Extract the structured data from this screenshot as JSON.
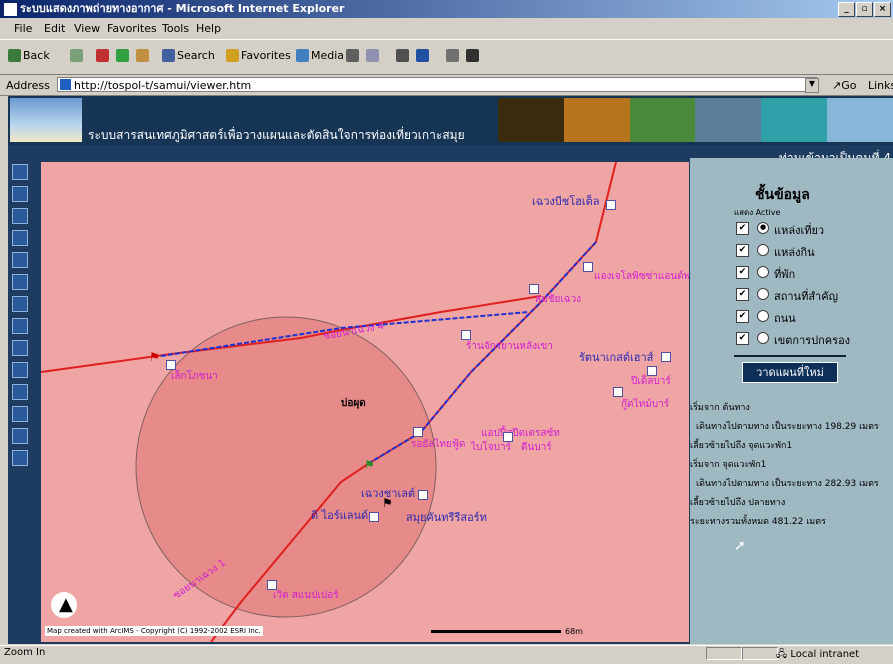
{
  "window": {
    "title": "ระบบแสดงภาพถ่ายทางอากาศ - Microsoft Internet Explorer"
  },
  "menu": [
    "File",
    "Edit",
    "View",
    "Favorites",
    "Tools",
    "Help"
  ],
  "toolbar": {
    "back": "Back",
    "search": "Search",
    "favorites": "Favorites",
    "media": "Media"
  },
  "address": {
    "label": "Address",
    "url": "http://tospol-t/samui/viewer.htm",
    "go": "Go",
    "links": "Links"
  },
  "banner": {
    "title": "ระบบสารสนเทศภูมิศาสตร์เพื่อวางแผนและตัดสินใจการท่องเที่ยวเกาะสมุย",
    "counter": "ท่านเข้ามาเป็นคนที่ 4"
  },
  "map": {
    "labels": [
      {
        "text": "เฉวงบีชโฮเต็ล",
        "cls": "blue"
      },
      {
        "text": "แองเจโลพิซซ่าแอนด์พ",
        "cls": ""
      },
      {
        "text": "สมชัยเฉวง",
        "cls": ""
      },
      {
        "text": "ซอยนาเฉวง 4",
        "cls": ""
      },
      {
        "text": "ร้านจักรยานหลังเขา",
        "cls": ""
      },
      {
        "text": "รัตนาเกสต์เฮาส์",
        "cls": "blue"
      },
      {
        "text": "ปีเด็ลบาร์",
        "cls": ""
      },
      {
        "text": "กู๊ดไทม์บาร์",
        "cls": ""
      },
      {
        "text": "เล็กโภชนา",
        "cls": ""
      },
      {
        "text": "บ่อผุด",
        "cls": "black"
      },
      {
        "text": "รอยัลไทยฟู้ด",
        "cls": ""
      },
      {
        "text": "แอปปี้สปีดเดรสซ์ท",
        "cls": ""
      },
      {
        "text": "ไบโจบาร์",
        "cls": ""
      },
      {
        "text": "ดีนบาร์",
        "cls": ""
      },
      {
        "text": "เฉวงชาเลต์",
        "cls": "blue"
      },
      {
        "text": "ดิ ไอร์แลนด์",
        "cls": "blue"
      },
      {
        "text": "สมุยคันทรีรีสอร์ท",
        "cls": "blue"
      },
      {
        "text": "ซอยนาเฉวง 1",
        "cls": ""
      },
      {
        "text": "เวิด สแนปเปอร์",
        "cls": ""
      }
    ],
    "copyright": "Map created with ArcIMS - Copyright (C) 1992-2002 ESRI Inc.",
    "scale_label": "68m"
  },
  "panel": {
    "title": "ชั้นข้อมูล",
    "subtitle": "แสดง Active",
    "layers": [
      {
        "name": "แหล่งเที่ยว",
        "checked": true,
        "active": true
      },
      {
        "name": "แหล่งกิน",
        "checked": true,
        "active": false
      },
      {
        "name": "ที่พัก",
        "checked": true,
        "active": false
      },
      {
        "name": "สถานที่สำคัญ",
        "checked": true,
        "active": false
      },
      {
        "name": "ถนน",
        "checked": true,
        "active": false
      },
      {
        "name": "เขตการปกครอง",
        "checked": true,
        "active": false
      }
    ],
    "button": "วาดแผนที่ใหม่",
    "directions": [
      "เริ่มจาก ต้นทาง",
      "เดินทางไปตามทาง เป็นระยะทาง 198.29 เมตร",
      "เลี้ยวซ้ายไปถึง จุดแวะพัก1",
      "เริ่มจาก จุดแวะพัก1",
      "เดินทางไปตามทาง เป็นระยะทาง 282.93 เมตร",
      "เลี้ยวซ้ายไปถึง ปลายทาง",
      "ระยะทางรวมทั้งหมด 481.22 เมตร"
    ]
  },
  "status": {
    "left": "Zoom In",
    "zone": "Local intranet"
  }
}
